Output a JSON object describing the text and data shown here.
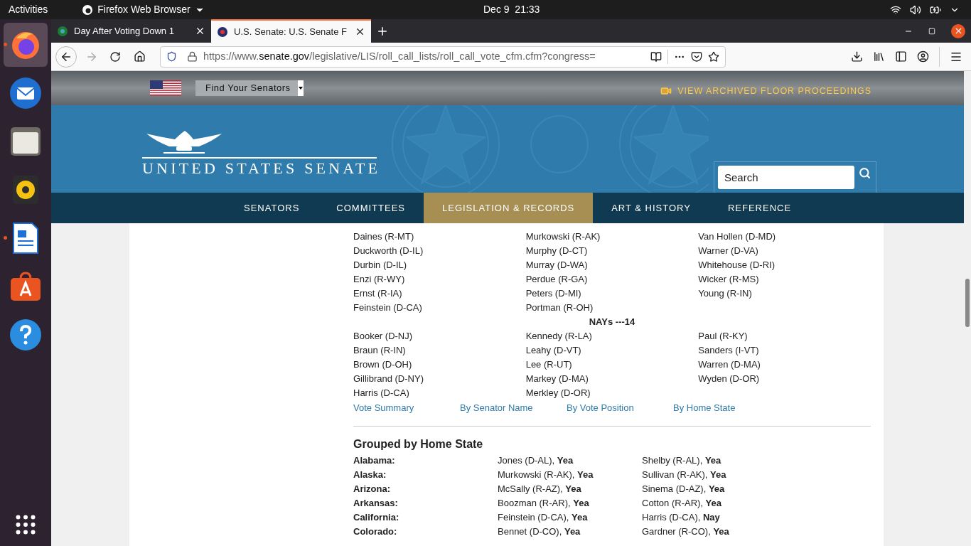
{
  "top_bar": {
    "activities": "Activities",
    "app_menu": "Firefox Web Browser",
    "clock": "Dec 9  21:33"
  },
  "dock": [
    {
      "kind": "firefox",
      "running": true,
      "selected": true
    },
    {
      "kind": "mail",
      "running": false,
      "selected": false
    },
    {
      "kind": "files",
      "running": false,
      "selected": false
    },
    {
      "kind": "music",
      "running": false,
      "selected": false
    },
    {
      "kind": "writer",
      "running": true,
      "selected": false
    },
    {
      "kind": "store",
      "running": false,
      "selected": false
    },
    {
      "kind": "help",
      "running": false,
      "selected": false
    }
  ],
  "tabs": [
    {
      "title": "Day After Voting Down 1",
      "selected": false
    },
    {
      "title": "U.S. Senate: U.S. Senate F",
      "selected": true
    }
  ],
  "url": {
    "scheme": "https://www.",
    "domain": "senate.gov",
    "path": "/legislative/LIS/roll_call_lists/roll_call_vote_cfm.cfm?congress="
  },
  "site": {
    "find_senators": "Find Your Senators",
    "archived": "VIEW ARCHIVED FLOOR PROCEEDINGS",
    "logo_text": "UNITED STATES SENATE",
    "search": {
      "placeholder": "Search"
    },
    "nav": [
      {
        "label": "SENATORS",
        "selected": false
      },
      {
        "label": "COMMITTEES",
        "selected": false
      },
      {
        "label": "LEGISLATION & RECORDS",
        "selected": true
      },
      {
        "label": "ART & HISTORY",
        "selected": false
      },
      {
        "label": "REFERENCE",
        "selected": false
      }
    ]
  },
  "yeas_columns": [
    [
      "Daines (R-MT)",
      "Duckworth (D-IL)",
      "Durbin (D-IL)",
      "Enzi (R-WY)",
      "Ernst (R-IA)",
      "Feinstein (D-CA)"
    ],
    [
      "Murkowski (R-AK)",
      "Murphy (D-CT)",
      "Murray (D-WA)",
      "Perdue (R-GA)",
      "Peters (D-MI)",
      "Portman (R-OH)"
    ],
    [
      "Van Hollen (D-MD)",
      "Warner (D-VA)",
      "Whitehouse (D-RI)",
      "Wicker (R-MS)",
      "Young (R-IN)"
    ]
  ],
  "nays_heading": "NAYs ---14",
  "nays_columns": [
    [
      "Booker (D-NJ)",
      "Braun (R-IN)",
      "Brown (D-OH)",
      "Gillibrand (D-NY)",
      "Harris (D-CA)"
    ],
    [
      "Kennedy (R-LA)",
      "Leahy (D-VT)",
      "Lee (R-UT)",
      "Markey (D-MA)",
      "Merkley (D-OR)"
    ],
    [
      "Paul (R-KY)",
      "Sanders (I-VT)",
      "Warren (D-MA)",
      "Wyden (D-OR)"
    ]
  ],
  "links": [
    "Vote Summary",
    "By Senator Name",
    "By Vote Position",
    "By Home State"
  ],
  "state_heading": "Grouped by Home State",
  "states": [
    {
      "state": "Alabama:",
      "senators": [
        {
          "name": "Jones (D-AL), ",
          "vote": "Yea"
        },
        {
          "name": "Shelby (R-AL), ",
          "vote": "Yea"
        }
      ]
    },
    {
      "state": "Alaska:",
      "senators": [
        {
          "name": "Murkowski (R-AK), ",
          "vote": "Yea"
        },
        {
          "name": "Sullivan (R-AK), ",
          "vote": "Yea"
        }
      ]
    },
    {
      "state": "Arizona:",
      "senators": [
        {
          "name": "McSally (R-AZ), ",
          "vote": "Yea"
        },
        {
          "name": "Sinema (D-AZ), ",
          "vote": "Yea"
        }
      ]
    },
    {
      "state": "Arkansas:",
      "senators": [
        {
          "name": "Boozman (R-AR), ",
          "vote": "Yea"
        },
        {
          "name": "Cotton (R-AR), ",
          "vote": "Yea"
        }
      ]
    },
    {
      "state": "California:",
      "senators": [
        {
          "name": "Feinstein (D-CA), ",
          "vote": "Yea"
        },
        {
          "name": "Harris (D-CA), ",
          "vote": "Nay"
        }
      ]
    },
    {
      "state": "Colorado:",
      "senators": [
        {
          "name": "Bennet (D-CO), ",
          "vote": "Yea"
        },
        {
          "name": "Gardner (R-CO), ",
          "vote": "Yea"
        }
      ]
    }
  ]
}
